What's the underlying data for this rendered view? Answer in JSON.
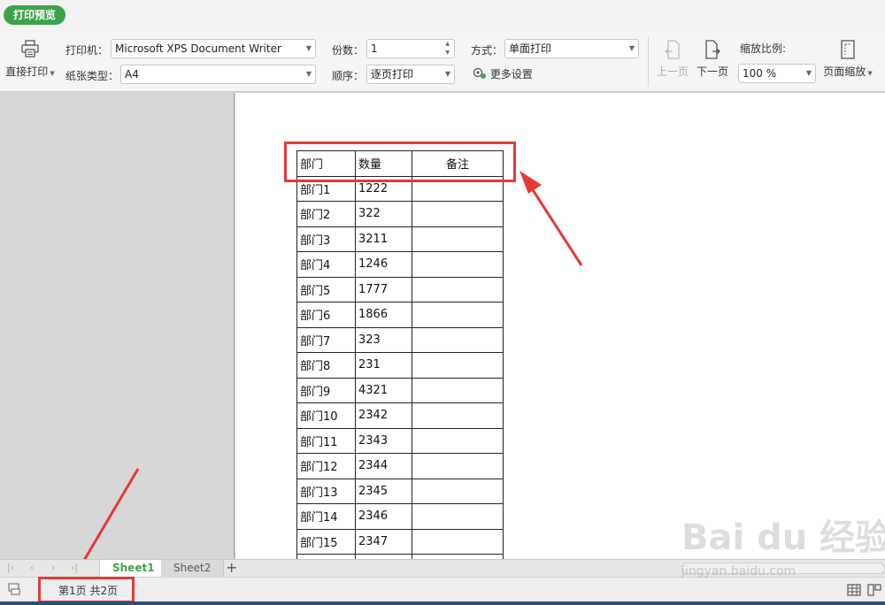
{
  "tab": {
    "label": "打印预览"
  },
  "ribbon": {
    "direct_print": "直接打印",
    "printer_label": "打印机：",
    "printer_value": "Microsoft XPS Document Writer",
    "paper_label": "纸张类型：",
    "paper_value": "A4",
    "copies_label": "份数：",
    "copies_value": "1",
    "order_label": "顺序：",
    "order_value": "逐页打印",
    "mode_label": "方式：",
    "mode_value": "单面打印",
    "more_settings": "更多设置",
    "prev_page": "上一页",
    "next_page": "下一页",
    "zoom_label": "缩放比例:",
    "zoom_value": "100 %",
    "page_zoom": "页面缩放"
  },
  "table": {
    "headers": [
      "部门",
      "数量",
      "备注"
    ],
    "rows": [
      [
        "部门1",
        "1222",
        ""
      ],
      [
        "部门2",
        "322",
        ""
      ],
      [
        "部门3",
        "3211",
        ""
      ],
      [
        "部门4",
        "1246",
        ""
      ],
      [
        "部门5",
        "1777",
        ""
      ],
      [
        "部门6",
        "1866",
        ""
      ],
      [
        "部门7",
        "323",
        ""
      ],
      [
        "部门8",
        "231",
        ""
      ],
      [
        "部门9",
        "4321",
        ""
      ],
      [
        "部门10",
        "2342",
        ""
      ],
      [
        "部门11",
        "2343",
        ""
      ],
      [
        "部门12",
        "2344",
        ""
      ],
      [
        "部门13",
        "2345",
        ""
      ],
      [
        "部门14",
        "2346",
        ""
      ],
      [
        "部门15",
        "2347",
        ""
      ]
    ]
  },
  "sheets": {
    "sheet1": "Sheet1",
    "sheet2": "Sheet2",
    "add": "+"
  },
  "status": {
    "page_info": "第1页 共2页"
  },
  "watermark": {
    "main": "Bai du 经验",
    "sub": "jingyan.baidu.com"
  },
  "colors": {
    "accent": "#3fa24b",
    "highlight": "#e53935"
  }
}
